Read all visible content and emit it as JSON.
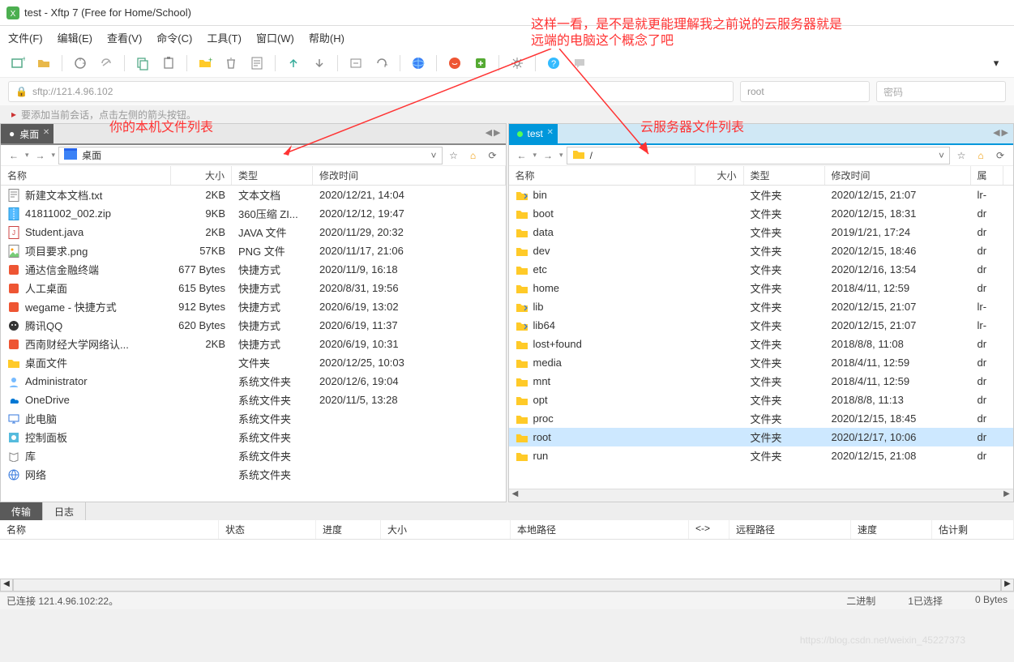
{
  "window": {
    "title": "test - Xftp 7 (Free for Home/School)"
  },
  "menu": {
    "file": "文件(F)",
    "edit": "编辑(E)",
    "view": "查看(V)",
    "cmd": "命令(C)",
    "tool": "工具(T)",
    "window": "窗口(W)",
    "help": "帮助(H)"
  },
  "address": {
    "url": "sftp://121.4.96.102",
    "user": "root",
    "pwd_placeholder": "密码"
  },
  "session_hint": "要添加当前会话，点击左侧的箭头按钮。",
  "annotations": {
    "top": "这样一看，是不是就更能理解我之前说的云服务器就是\n远端的电脑这个概念了吧",
    "left": "你的本机文件列表",
    "right": "云服务器文件列表"
  },
  "local": {
    "tab": "桌面",
    "path": "桌面",
    "headers": {
      "name": "名称",
      "size": "大小",
      "type": "类型",
      "date": "修改时间"
    },
    "rows": [
      {
        "icon": "txt",
        "name": "新建文本文档.txt",
        "size": "2KB",
        "type": "文本文档",
        "date": "2020/12/21, 14:04"
      },
      {
        "icon": "zip",
        "name": "41811002_002.zip",
        "size": "9KB",
        "type": "360压缩 ZI...",
        "date": "2020/12/12, 19:47"
      },
      {
        "icon": "java",
        "name": "Student.java",
        "size": "2KB",
        "type": "JAVA 文件",
        "date": "2020/11/29, 20:32"
      },
      {
        "icon": "png",
        "name": "项目要求.png",
        "size": "57KB",
        "type": "PNG 文件",
        "date": "2020/11/17, 21:06"
      },
      {
        "icon": "app",
        "name": "通达信金融终端",
        "size": "677 Bytes",
        "type": "快捷方式",
        "date": "2020/11/9, 16:18"
      },
      {
        "icon": "app",
        "name": "人工桌面",
        "size": "615 Bytes",
        "type": "快捷方式",
        "date": "2020/8/31, 19:56"
      },
      {
        "icon": "app",
        "name": "wegame - 快捷方式",
        "size": "912 Bytes",
        "type": "快捷方式",
        "date": "2020/6/19, 13:02"
      },
      {
        "icon": "qq",
        "name": "腾讯QQ",
        "size": "620 Bytes",
        "type": "快捷方式",
        "date": "2020/6/19, 11:37"
      },
      {
        "icon": "app",
        "name": "西南财经大学网络认...",
        "size": "2KB",
        "type": "快捷方式",
        "date": "2020/6/19, 10:31"
      },
      {
        "icon": "folder",
        "name": "桌面文件",
        "size": "",
        "type": "文件夹",
        "date": "2020/12/25, 10:03"
      },
      {
        "icon": "user",
        "name": "Administrator",
        "size": "",
        "type": "系统文件夹",
        "date": "2020/12/6, 19:04"
      },
      {
        "icon": "onedrive",
        "name": "OneDrive",
        "size": "",
        "type": "系统文件夹",
        "date": "2020/11/5, 13:28"
      },
      {
        "icon": "pc",
        "name": "此电脑",
        "size": "",
        "type": "系统文件夹",
        "date": ""
      },
      {
        "icon": "cpl",
        "name": "控制面板",
        "size": "",
        "type": "系统文件夹",
        "date": ""
      },
      {
        "icon": "lib",
        "name": "库",
        "size": "",
        "type": "系统文件夹",
        "date": ""
      },
      {
        "icon": "net",
        "name": "网络",
        "size": "",
        "type": "系统文件夹",
        "date": ""
      }
    ]
  },
  "remote": {
    "tab": "test",
    "path": "/",
    "headers": {
      "name": "名称",
      "size": "大小",
      "type": "类型",
      "date": "修改时间",
      "attr": "属"
    },
    "rows": [
      {
        "icon": "link",
        "name": "bin",
        "size": "",
        "type": "文件夹",
        "date": "2020/12/15, 21:07",
        "attr": "lr-"
      },
      {
        "icon": "folder",
        "name": "boot",
        "size": "",
        "type": "文件夹",
        "date": "2020/12/15, 18:31",
        "attr": "dr"
      },
      {
        "icon": "folder",
        "name": "data",
        "size": "",
        "type": "文件夹",
        "date": "2019/1/21, 17:24",
        "attr": "dr"
      },
      {
        "icon": "folder",
        "name": "dev",
        "size": "",
        "type": "文件夹",
        "date": "2020/12/15, 18:46",
        "attr": "dr"
      },
      {
        "icon": "folder",
        "name": "etc",
        "size": "",
        "type": "文件夹",
        "date": "2020/12/16, 13:54",
        "attr": "dr"
      },
      {
        "icon": "folder",
        "name": "home",
        "size": "",
        "type": "文件夹",
        "date": "2018/4/11, 12:59",
        "attr": "dr"
      },
      {
        "icon": "link",
        "name": "lib",
        "size": "",
        "type": "文件夹",
        "date": "2020/12/15, 21:07",
        "attr": "lr-"
      },
      {
        "icon": "link",
        "name": "lib64",
        "size": "",
        "type": "文件夹",
        "date": "2020/12/15, 21:07",
        "attr": "lr-"
      },
      {
        "icon": "folder",
        "name": "lost+found",
        "size": "",
        "type": "文件夹",
        "date": "2018/8/8, 11:08",
        "attr": "dr"
      },
      {
        "icon": "folder",
        "name": "media",
        "size": "",
        "type": "文件夹",
        "date": "2018/4/11, 12:59",
        "attr": "dr"
      },
      {
        "icon": "folder",
        "name": "mnt",
        "size": "",
        "type": "文件夹",
        "date": "2018/4/11, 12:59",
        "attr": "dr"
      },
      {
        "icon": "folder",
        "name": "opt",
        "size": "",
        "type": "文件夹",
        "date": "2018/8/8, 11:13",
        "attr": "dr"
      },
      {
        "icon": "folder",
        "name": "proc",
        "size": "",
        "type": "文件夹",
        "date": "2020/12/15, 18:45",
        "attr": "dr"
      },
      {
        "icon": "folder",
        "name": "root",
        "size": "",
        "type": "文件夹",
        "date": "2020/12/17, 10:06",
        "attr": "dr",
        "selected": true
      },
      {
        "icon": "folder",
        "name": "run",
        "size": "",
        "type": "文件夹",
        "date": "2020/12/15, 21:08",
        "attr": "dr"
      }
    ]
  },
  "transfer": {
    "tabs": {
      "active": "传输",
      "log": "日志"
    },
    "headers": {
      "name": "名称",
      "status": "状态",
      "progress": "进度",
      "size": "大小",
      "local": "本地路径",
      "arrow": "<->",
      "remote": "远程路径",
      "speed": "速度",
      "eta": "估计剩"
    }
  },
  "status": {
    "conn": "已连接 121.4.96.102:22。",
    "binary": "二进制",
    "selected": "1已选择",
    "bytes": "0 Bytes"
  },
  "watermark": "https://blog.csdn.net/weixin_45227373"
}
